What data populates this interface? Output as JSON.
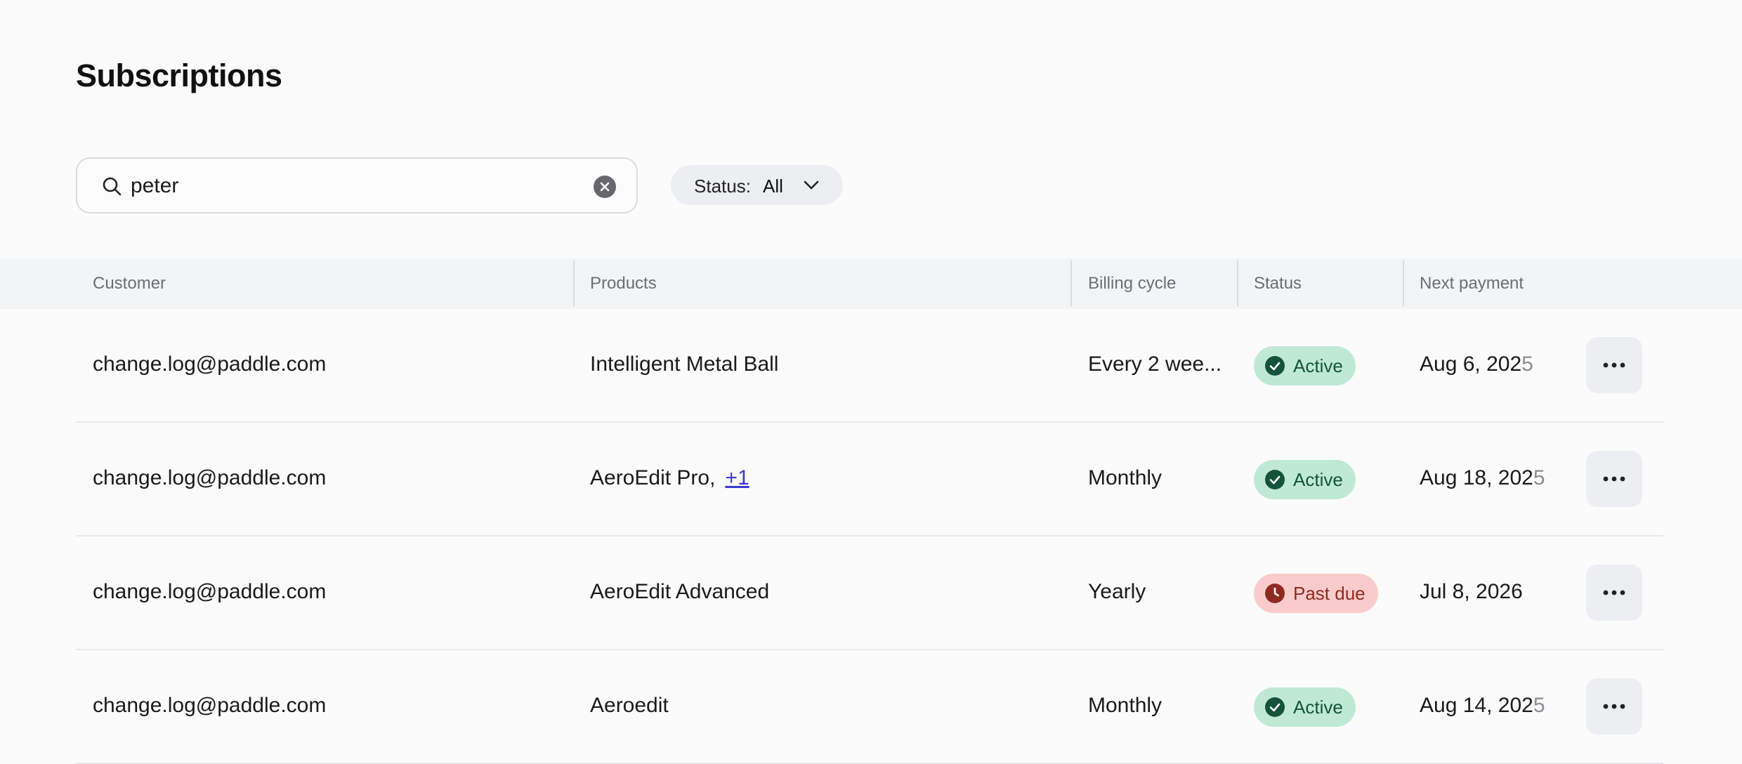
{
  "page": {
    "title": "Subscriptions"
  },
  "search": {
    "value": "peter"
  },
  "filter": {
    "label": "Status:",
    "value": "All"
  },
  "table": {
    "columns": [
      "Customer",
      "Products",
      "Billing cycle",
      "Status",
      "Next payment"
    ],
    "rows": [
      {
        "customer": "change.log@paddle.com",
        "product": "Intelligent Metal Ball",
        "product_more": "",
        "cycle": "Every 2 wee...",
        "status": "Active",
        "next_main": "Aug 6, 202",
        "next_tail": "5"
      },
      {
        "customer": "change.log@paddle.com",
        "product": "AeroEdit Pro,",
        "product_more": "+1",
        "cycle": "Monthly",
        "status": "Active",
        "next_main": "Aug 18, 202",
        "next_tail": "5"
      },
      {
        "customer": "change.log@paddle.com",
        "product": "AeroEdit Advanced",
        "product_more": "",
        "cycle": "Yearly",
        "status": "Past due",
        "next_main": "Jul 8, 2026",
        "next_tail": ""
      },
      {
        "customer": "change.log@paddle.com",
        "product": "Aeroedit",
        "product_more": "",
        "cycle": "Monthly",
        "status": "Active",
        "next_main": "Aug 14, 202",
        "next_tail": "5"
      }
    ]
  },
  "colors": {
    "active_bg": "#bfe9d5",
    "active_fg": "#15533a",
    "pastdue_bg": "#f9cccb",
    "pastdue_fg": "#8f2a22",
    "link": "#3a3ad0"
  },
  "icons": {
    "search": "search-icon",
    "clear": "clear-circle-icon",
    "chevron": "chevron-down-icon",
    "active": "check-circle-icon",
    "pastdue": "clock-icon",
    "menu": "more-horizontal-icon"
  }
}
